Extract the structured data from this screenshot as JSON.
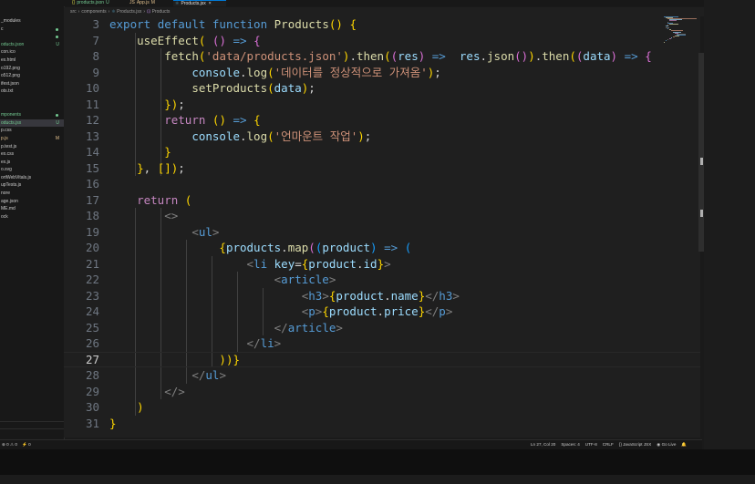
{
  "tabs": [
    {
      "label": "products.json",
      "mod": "U",
      "icon": "{}",
      "active": false
    },
    {
      "label": "App.js",
      "mod": "M",
      "icon": "JS",
      "active": false
    },
    {
      "label": "Products.jsx",
      "mod": "U",
      "icon": "⚛",
      "active": true
    }
  ],
  "tab_close": "×",
  "breadcrumb": [
    "src",
    "components",
    "Products.jsx",
    "Products"
  ],
  "sidebar": [
    {
      "label": "_modules",
      "badge": ""
    },
    {
      "label": "c",
      "badge": "",
      "dot": "#73c991"
    },
    {
      "label": "",
      "badge": "",
      "dot": "#73c991"
    },
    {
      "label": "oducts.json",
      "badge": "U",
      "selected": false,
      "color": "#73c991"
    },
    {
      "label": "con.ico",
      "badge": ""
    },
    {
      "label": "ex.html",
      "badge": ""
    },
    {
      "label": "o192.png",
      "badge": ""
    },
    {
      "label": "o512.png",
      "badge": ""
    },
    {
      "label": "ifest.json",
      "badge": ""
    },
    {
      "label": "ots.txt",
      "badge": ""
    },
    {
      "label": "",
      "badge": ""
    },
    {
      "label": "",
      "badge": ""
    },
    {
      "label": "mponents",
      "badge": "",
      "dot": "#73c991",
      "color": "#73c991"
    },
    {
      "label": "oducts.jsx",
      "badge": "U",
      "selected": true,
      "color": "#73c991"
    },
    {
      "label": "p.css",
      "badge": ""
    },
    {
      "label": "p.js",
      "badge": "M",
      "color": "#e2c08d"
    },
    {
      "label": "p.test.js",
      "badge": ""
    },
    {
      "label": "ex.css",
      "badge": ""
    },
    {
      "label": "ex.js",
      "badge": ""
    },
    {
      "label": "o.svg",
      "badge": ""
    },
    {
      "label": "ortWebVitals.js",
      "badge": ""
    },
    {
      "label": "upTests.js",
      "badge": ""
    },
    {
      "label": "nore",
      "badge": ""
    },
    {
      "label": "age.json",
      "badge": ""
    },
    {
      "label": "ME.md",
      "badge": ""
    },
    {
      "label": "ock",
      "badge": ""
    }
  ],
  "editor": {
    "current_line": 27,
    "lines": [
      {
        "num": "3",
        "code": "export default function Products() {"
      },
      {
        "num": "7",
        "code": "    useEffect( () => {"
      },
      {
        "num": "8",
        "code": "        fetch('data/products.json').then((res) =>  res.json()).then((data) => {"
      },
      {
        "num": "9",
        "code": "            console.log('데이터를 정상적으로 가져옴');"
      },
      {
        "num": "10",
        "code": "            setProducts(data);"
      },
      {
        "num": "11",
        "code": "        });"
      },
      {
        "num": "12",
        "code": "        return () => {"
      },
      {
        "num": "13",
        "code": "            console.log('언마운트 작업');"
      },
      {
        "num": "14",
        "code": "        }"
      },
      {
        "num": "15",
        "code": "    }, []);"
      },
      {
        "num": "16",
        "code": ""
      },
      {
        "num": "17",
        "code": "    return ("
      },
      {
        "num": "18",
        "code": "        <>"
      },
      {
        "num": "19",
        "code": "            <ul>"
      },
      {
        "num": "20",
        "code": "                {products.map((product) => ("
      },
      {
        "num": "21",
        "code": "                    <li key={product.id}>"
      },
      {
        "num": "22",
        "code": "                        <article>"
      },
      {
        "num": "23",
        "code": "                            <h3>{product.name}</h3>"
      },
      {
        "num": "24",
        "code": "                            <p>{product.price}</p>"
      },
      {
        "num": "25",
        "code": "                        </article>"
      },
      {
        "num": "26",
        "code": "                    </li>"
      },
      {
        "num": "27",
        "code": "                ))}"
      },
      {
        "num": "28",
        "code": "            </ul>"
      },
      {
        "num": "29",
        "code": "        </>"
      },
      {
        "num": "30",
        "code": "    )"
      },
      {
        "num": "31",
        "code": "}"
      }
    ]
  },
  "status_left": [
    "⊗ 0 ⚠ 0",
    "⚡ 0"
  ],
  "status_right": [
    "Ln 27, Col 20",
    "Spaces: 4",
    "UTF-8",
    "CRLF",
    "{} JavaScript JSX",
    "◉ Go Live",
    "🔔"
  ],
  "colors": {
    "editor_bg": "#1f1f1f",
    "keyword": "#569cd6",
    "control": "#c586c0",
    "function": "#dcdcaa",
    "string": "#ce9178",
    "variable": "#9cdcfe",
    "git_untracked": "#73c991",
    "git_modified": "#e2c08d"
  }
}
